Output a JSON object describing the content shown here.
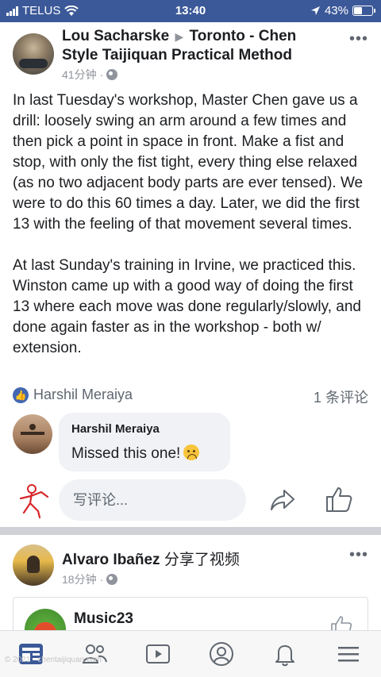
{
  "status_bar": {
    "carrier": "TELUS",
    "time": "13:40",
    "battery": "43%"
  },
  "post": {
    "author": "Lou Sacharske",
    "group": "Toronto - Chen Style Taijiquan Practical Method",
    "time": "41分钟",
    "body_paragraphs": [
      "In last Tuesday's workshop, Master Chen gave us a drill: loosely swing an arm around a few times and then pick a point in space in front. Make a fist and stop, with only the fist tight, every thing else relaxed (as no two adjacent body parts are ever tensed). We were to do this 60 times a day. Later, we did the first 13 with the feeling of that movement several times.",
      "At last Sunday's training in Irvine, we practiced this. Winston came up with a good way of doing the first 13 where each move was done regularly/slowly, and done again faster as in the workshop - both w/ extension."
    ],
    "reaction_name": "Harshil Meraiya",
    "comment_count": "1 条评论",
    "comment": {
      "author": "Harshil Meraiya",
      "text": "Missed this one!"
    },
    "write_comment_placeholder": "写评论..."
  },
  "post2": {
    "author": "Alvaro Ibañez",
    "action": "分享了视频",
    "time": "18分钟",
    "shared_page": "Music23"
  },
  "tab_bar": {
    "icons": [
      "feed-icon",
      "friends-icon",
      "watch-icon",
      "profile-icon",
      "notifications-icon",
      "menu-icon"
    ]
  },
  "watermark": "© 2021 · chentaijiquan.com",
  "colors": {
    "brand_blue": "#3b5998",
    "like_blue": "#4267b2"
  }
}
